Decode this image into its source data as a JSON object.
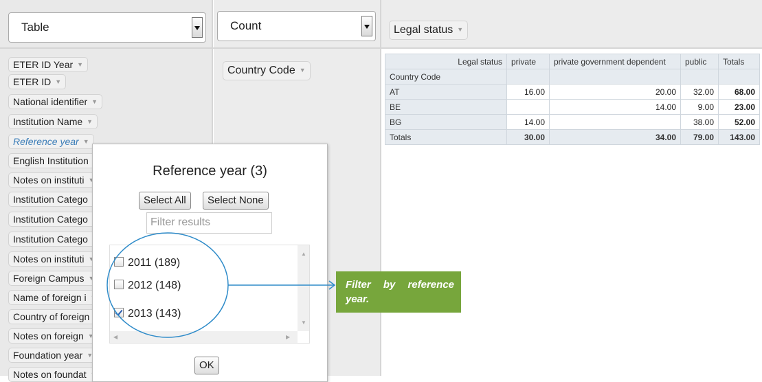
{
  "renderer_select": {
    "value": "Table"
  },
  "aggregator_select": {
    "value": "Count"
  },
  "column_pill": "Legal status",
  "row_pill": "Country Code",
  "attributes": [
    "ETER ID Year",
    "ETER ID",
    "National identifier",
    "Institution Name",
    "Reference year",
    "English Institution",
    "Notes on instituti",
    "Institution Catego",
    "Institution Catego",
    "Institution Catego",
    "Notes on instituti",
    "Foreign Campus",
    "Name of foreign i",
    "Country of foreign",
    "Notes on foreign",
    "Foundation year",
    "Notes on foundat"
  ],
  "pivot": {
    "col_attr": "Legal status",
    "row_attr": "Country Code",
    "columns": [
      "private",
      "private government dependent",
      "public",
      "Totals"
    ],
    "rows": [
      {
        "label": "AT",
        "values": [
          "16.00",
          "20.00",
          "32.00",
          "68.00"
        ]
      },
      {
        "label": "BE",
        "values": [
          "",
          "14.00",
          "9.00",
          "23.00"
        ]
      },
      {
        "label": "BG",
        "values": [
          "14.00",
          "",
          "38.00",
          "52.00"
        ]
      },
      {
        "label": "Totals",
        "values": [
          "30.00",
          "34.00",
          "79.00",
          "143.00"
        ]
      }
    ]
  },
  "popup": {
    "title": "Reference year (3)",
    "select_all": "Select All",
    "select_none": "Select None",
    "filter_placeholder": "Filter results",
    "items": [
      {
        "label": "2011 (189)",
        "checked": false
      },
      {
        "label": "2012 (148)",
        "checked": false
      },
      {
        "label": "2013 (143)",
        "checked": true
      }
    ],
    "ok": "OK"
  },
  "callout": {
    "line1_a": "Filter",
    "line1_b": "by",
    "line1_c": "reference",
    "line2": "year."
  },
  "colors": {
    "callout_bg": "#77a63c",
    "annotation_blue": "#2e8bc9",
    "link_italic": "#3b7db8"
  }
}
